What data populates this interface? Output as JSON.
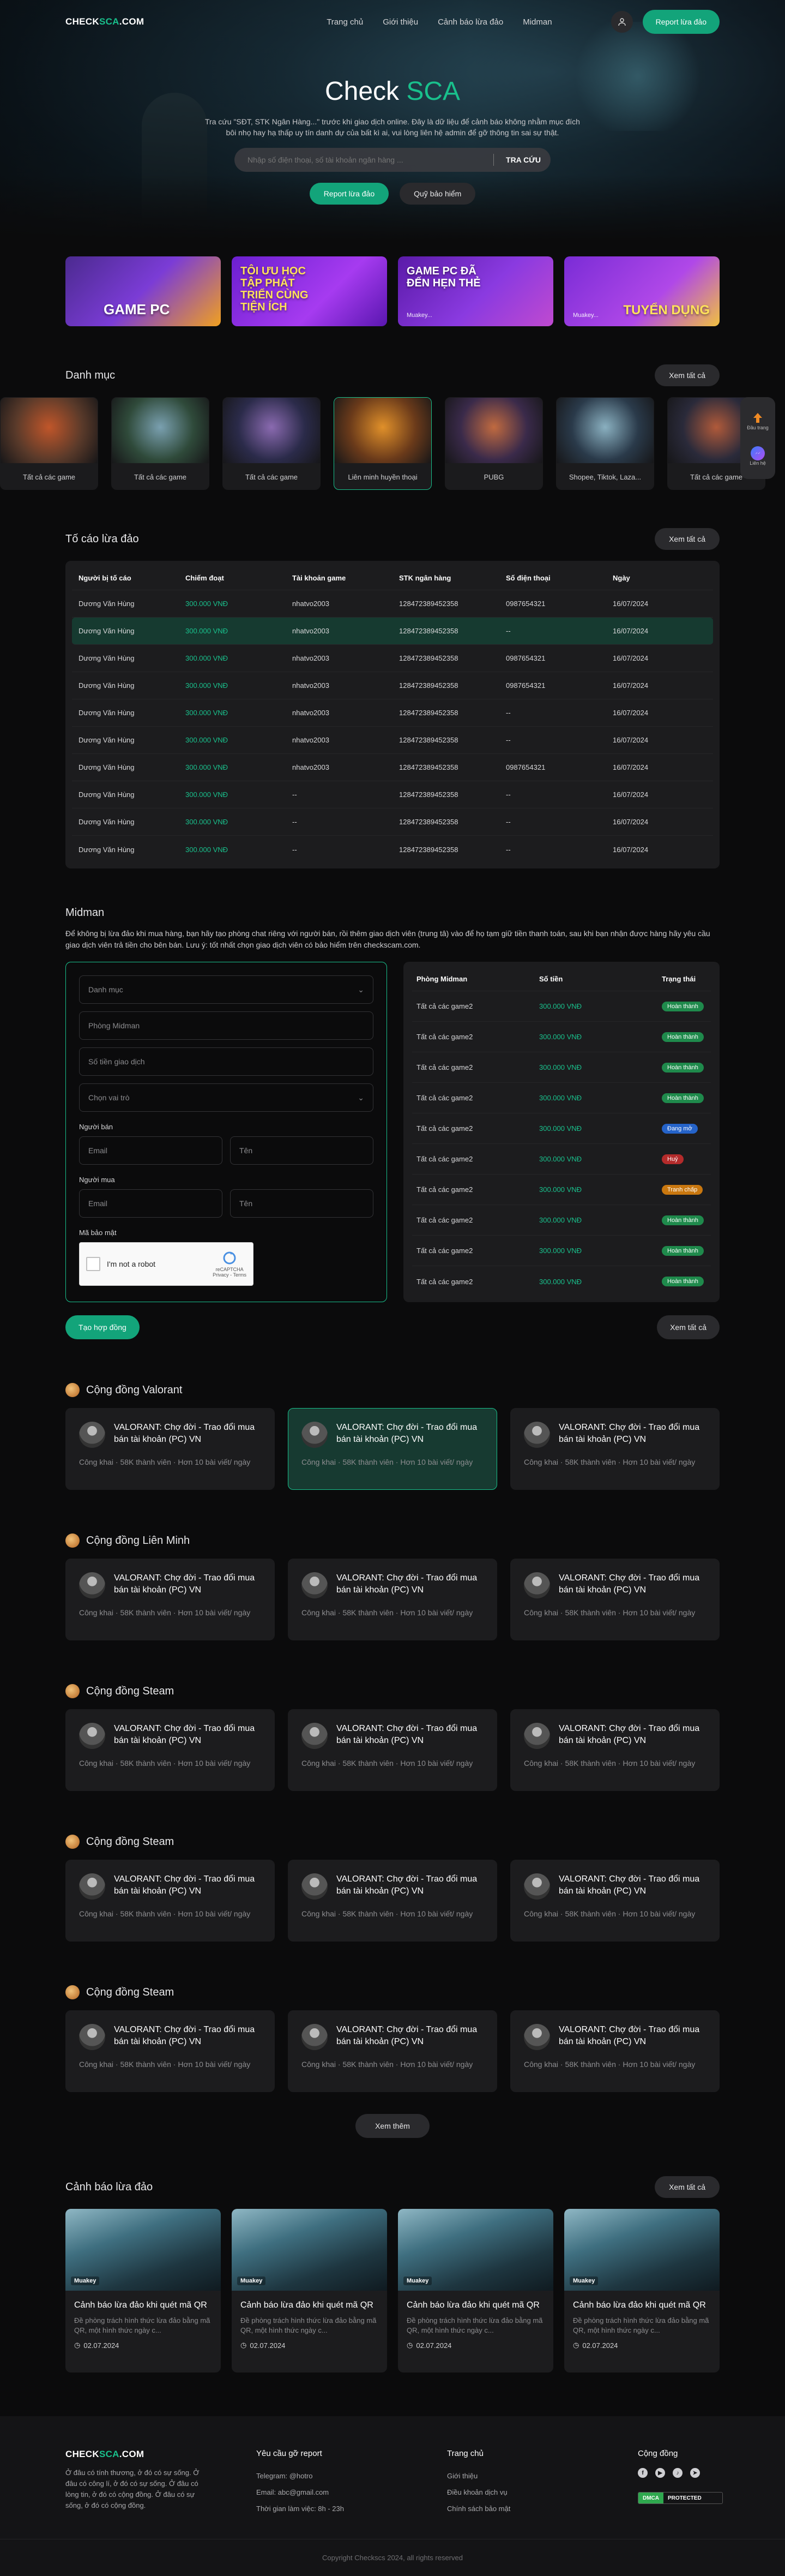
{
  "brand": {
    "logo_main": "CHECK",
    "logo_accent": "SCA",
    "logo_tail": ".COM"
  },
  "nav": {
    "items": [
      "Trang chủ",
      "Giới thiệu",
      "Cảnh báo lừa đảo",
      "Midman"
    ],
    "report_label": "Report lừa đảo"
  },
  "hero": {
    "title_main": "Check ",
    "title_accent": "SCA",
    "subtitle": "Tra cứu \"SĐT, STK Ngân Hàng...\" trước khi giao dịch online. Đây là dữ liệu để cảnh báo không nhằm mục đích bôi nhọ hay hạ thấp uy tín danh dự của bất kì ai, vui lòng liên hệ admin để gỡ thông tin sai sự thật.",
    "search_placeholder": "Nhập số điện thoại, số tài khoản ngân hàng ...",
    "search_button": "TRA CỨU",
    "btn_report": "Report lừa đảo",
    "btn_fund": "Quỹ bảo hiểm"
  },
  "banners": [
    {
      "title": "GAME PC",
      "sub": ""
    },
    {
      "title": "TÔI ƯU HỌC TẬP PHÁT TRIỂN CÙNG TIỆN ÍCH",
      "sub": ""
    },
    {
      "title": "GAME PC ĐÃ ĐẾN HẸN THẺ",
      "sub": "Muakey..."
    },
    {
      "title": "TUYỂN DỤNG",
      "sub": "Muakey..."
    }
  ],
  "categories": {
    "title": "Danh mục",
    "view_all": "Xem tất cả",
    "items": [
      "Tất cả các game",
      "Tất cả các game",
      "Tất cả các game",
      "Liên minh huyền thoại",
      "PUBG",
      "Shopee, Tiktok, Laza...",
      "Tất cả các game"
    ],
    "float": {
      "top_label": "Đầu trang",
      "bottom_label": "Liên hệ"
    }
  },
  "reports": {
    "title": "Tố cáo lừa đảo",
    "view_all": "Xem tất cả",
    "columns": [
      "Người bị tố cáo",
      "Chiếm đoạt",
      "Tài khoản game",
      "STK ngân hàng",
      "Số điện thoại",
      "Ngày"
    ],
    "rows": [
      [
        "Dương Văn Hùng",
        "300.000 VNĐ",
        "nhatvo2003",
        "128472389452358",
        "0987654321",
        "16/07/2024"
      ],
      [
        "Dương Văn Hùng",
        "300.000 VNĐ",
        "nhatvo2003",
        "128472389452358",
        "--",
        "16/07/2024"
      ],
      [
        "Dương Văn Hùng",
        "300.000 VNĐ",
        "nhatvo2003",
        "128472389452358",
        "0987654321",
        "16/07/2024"
      ],
      [
        "Dương Văn Hùng",
        "300.000 VNĐ",
        "nhatvo2003",
        "128472389452358",
        "0987654321",
        "16/07/2024"
      ],
      [
        "Dương Văn Hùng",
        "300.000 VNĐ",
        "nhatvo2003",
        "128472389452358",
        "--",
        "16/07/2024"
      ],
      [
        "Dương Văn Hùng",
        "300.000 VNĐ",
        "nhatvo2003",
        "128472389452358",
        "--",
        "16/07/2024"
      ],
      [
        "Dương Văn Hùng",
        "300.000 VNĐ",
        "nhatvo2003",
        "128472389452358",
        "0987654321",
        "16/07/2024"
      ],
      [
        "Dương Văn Hùng",
        "300.000 VNĐ",
        "--",
        "128472389452358",
        "--",
        "16/07/2024"
      ],
      [
        "Dương Văn Hùng",
        "300.000 VNĐ",
        "--",
        "128472389452358",
        "--",
        "16/07/2024"
      ],
      [
        "Dương Văn Hùng",
        "300.000 VNĐ",
        "--",
        "128472389452358",
        "--",
        "16/07/2024"
      ]
    ]
  },
  "midman": {
    "title": "Midman",
    "description": "Để không bị lừa đảo khi mua hàng, bạn hãy tạo phòng chat riêng với người bán, rồi thêm giao dịch viên (trung tâ) vào để họ tạm giữ tiền thanh toán, sau khi bạn nhận được hàng hãy yêu cầu giao dịch viên trả tiền cho bên bán. Lưu ý: tốt nhất chọn giao dịch viên có bảo hiểm trên checkscam.com.",
    "form": {
      "category": "Danh mục",
      "room": "Phòng Midman",
      "amount": "Số tiền giao dịch",
      "role": "Chọn vai trò",
      "seller_label": "Người bán",
      "buyer_label": "Người mua",
      "email": "Email",
      "name": "Tên",
      "captcha_label": "Mã bảo mật",
      "captcha_text": "I'm not a robot",
      "captcha_brand": "reCAPTCHA",
      "captcha_terms": "Privacy - Terms"
    },
    "table": {
      "columns": [
        "Phòng Midman",
        "Số tiền",
        "Trạng thái"
      ],
      "rows": [
        {
          "room": "Tất cả các game2",
          "amount": "300.000 VNĐ",
          "status": "Hoàn thành",
          "color": "#1f8a4c"
        },
        {
          "room": "Tất cả các game2",
          "amount": "300.000 VNĐ",
          "status": "Hoàn thành",
          "color": "#1f8a4c"
        },
        {
          "room": "Tất cả các game2",
          "amount": "300.000 VNĐ",
          "status": "Hoàn thành",
          "color": "#1f8a4c"
        },
        {
          "room": "Tất cả các game2",
          "amount": "300.000 VNĐ",
          "status": "Hoàn thành",
          "color": "#1f8a4c"
        },
        {
          "room": "Tất cả các game2",
          "amount": "300.000 VNĐ",
          "status": "Đang mở",
          "color": "#2563c9"
        },
        {
          "room": "Tất cả các game2",
          "amount": "300.000 VNĐ",
          "status": "Huỷ",
          "color": "#b42b2b"
        },
        {
          "room": "Tất cả các game2",
          "amount": "300.000 VNĐ",
          "status": "Tranh chấp",
          "color": "#c9770f"
        },
        {
          "room": "Tất cả các game2",
          "amount": "300.000 VNĐ",
          "status": "Hoàn thành",
          "color": "#1f8a4c"
        },
        {
          "room": "Tất cả các game2",
          "amount": "300.000 VNĐ",
          "status": "Hoàn thành",
          "color": "#1f8a4c"
        },
        {
          "room": "Tất cả các game2",
          "amount": "300.000 VNĐ",
          "status": "Hoàn thành",
          "color": "#1f8a4c"
        }
      ]
    },
    "create_button": "Tạo hợp đồng",
    "view_all": "Xem tất cả"
  },
  "communities": [
    {
      "title": "Cộng đồng Valorant"
    },
    {
      "title": "Cộng đồng Liên Minh"
    },
    {
      "title": "Cộng đồng Steam"
    },
    {
      "title": "Cộng đồng Steam"
    },
    {
      "title": "Cộng đồng Steam"
    }
  ],
  "community_card": {
    "name": "VALORANT: Chợ đời - Trao đổi mua bán tài khoản (PC) VN",
    "info": "Công khai · 58K thành viên · Hơn 10 bài viết/ ngày"
  },
  "more_button": "Xem thêm",
  "warnings": {
    "title": "Cảnh báo lừa đảo",
    "view_all": "Xem tất cả",
    "card": {
      "logo": "Muakey",
      "title": "Cảnh báo lừa đảo khi quét mã QR",
      "desc": "Đề phòng trách hình thức lừa đảo bằng mã QR, một hình thức ngày c...",
      "date": "02.07.2024"
    }
  },
  "footer": {
    "desc": "Ở đâu có tính thương, ở đó có sự sống. Ở đâu có công lí, ở đó có sự sống. Ở đâu có lòng tin, ở đó có cộng đồng. Ở đâu có sự sống, ở đó có cộng đồng.",
    "report_title": "Yêu cầu gỡ report",
    "report_items": [
      "Telegram: @hotro",
      "Email: abc@gmail.com",
      "Thời gian làm việc: 8h - 23h"
    ],
    "pages_title": "Trang chủ",
    "pages_items": [
      "Giới thiệu",
      "Điều khoản dịch vụ",
      "Chính sách bảo mật"
    ],
    "community_title": "Cộng đồng",
    "dmca_a": "DMCA",
    "dmca_b": "PROTECTED",
    "copyright": "Copyright Checkscs 2024, all rights reserved"
  },
  "colors": {
    "accent": "#19c08c",
    "bg": "#0b0b0c",
    "card": "#1c1c1e"
  }
}
